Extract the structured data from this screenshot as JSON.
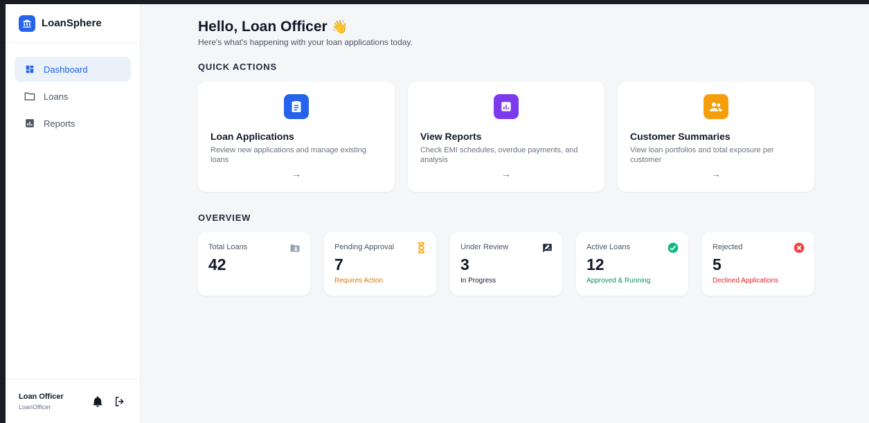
{
  "brand": {
    "name": "LoanSphere",
    "icon": "bank-icon",
    "color": "#2563eb"
  },
  "nav": [
    {
      "label": "Dashboard",
      "icon": "dashboard-icon",
      "active": true
    },
    {
      "label": "Loans",
      "icon": "folder-icon",
      "active": false
    },
    {
      "label": "Reports",
      "icon": "chart-icon",
      "active": false
    }
  ],
  "user": {
    "name": "Loan Officer",
    "role": "LoanOfficer"
  },
  "header": {
    "greeting": "Hello, Loan Officer",
    "wave": "👋",
    "subtitle": "Here's what's happening with your loan applications today."
  },
  "quick_actions": {
    "title": "QUICK ACTIONS",
    "cards": [
      {
        "title": "Loan Applications",
        "description": "Review new applications and manage existing loans",
        "icon": "clipboard-icon",
        "color": "#2563eb",
        "arrow": "→"
      },
      {
        "title": "View Reports",
        "description": "Check EMI schedules, overdue payments, and analysis",
        "icon": "bar-chart-icon",
        "color": "#7c3aed",
        "arrow": "→"
      },
      {
        "title": "Customer Summaries",
        "description": "View loan portfolios and total exposure per customer",
        "icon": "people-icon",
        "color": "#f59e0b",
        "arrow": "→"
      }
    ]
  },
  "overview": {
    "title": "OVERVIEW",
    "stats": [
      {
        "label": "Total Loans",
        "value": "42",
        "sub": "",
        "sub_color": "#111827",
        "icon": "folder-user-icon",
        "icon_color": "#9ca3af"
      },
      {
        "label": "Pending Approval",
        "value": "7",
        "sub": "Requires Action",
        "sub_color": "#d97706",
        "icon": "hourglass-icon",
        "icon_color": "#f59e0b"
      },
      {
        "label": "Under Review",
        "value": "3",
        "sub": "In Progress",
        "sub_color": "#111827",
        "icon": "rate-review-icon",
        "icon_color": "#1f2937"
      },
      {
        "label": "Active Loans",
        "value": "12",
        "sub": "Approved & Running",
        "sub_color": "#059669",
        "icon": "check-circle-icon",
        "icon_color": "#10b981"
      },
      {
        "label": "Rejected",
        "value": "5",
        "sub": "Declined Applications",
        "sub_color": "#dc2626",
        "icon": "x-circle-icon",
        "icon_color": "#ef4444"
      }
    ]
  }
}
